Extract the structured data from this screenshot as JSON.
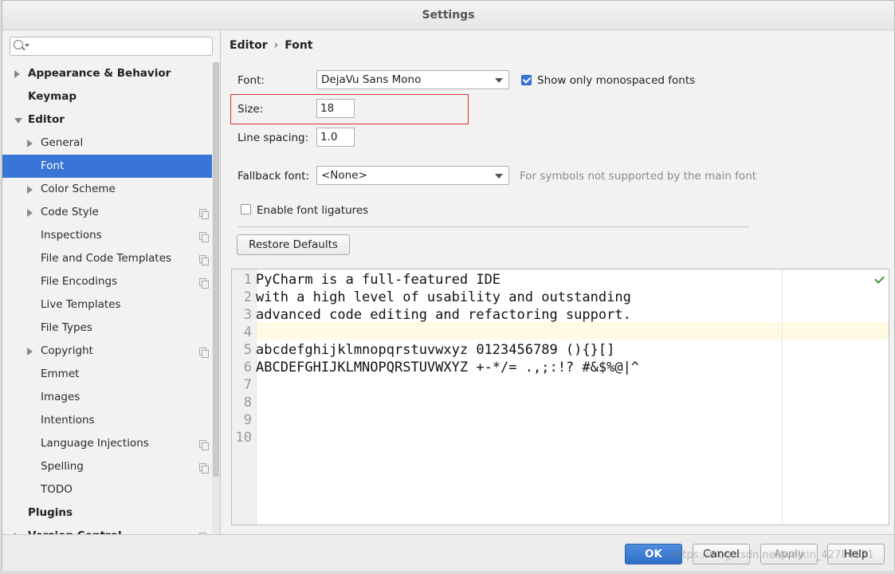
{
  "window": {
    "title": "Settings"
  },
  "search": {
    "placeholder": ""
  },
  "sidebar": {
    "items": [
      {
        "label": "Appearance & Behavior",
        "level": 0,
        "arrow": "right"
      },
      {
        "label": "Keymap",
        "level": 0,
        "arrow": ""
      },
      {
        "label": "Editor",
        "level": 0,
        "arrow": "down"
      },
      {
        "label": "General",
        "level": 1,
        "arrow": "right"
      },
      {
        "label": "Font",
        "level": 1,
        "arrow": "",
        "selected": true
      },
      {
        "label": "Color Scheme",
        "level": 1,
        "arrow": "right"
      },
      {
        "label": "Code Style",
        "level": 1,
        "arrow": "right",
        "copy": true
      },
      {
        "label": "Inspections",
        "level": 1,
        "arrow": "",
        "copy": true
      },
      {
        "label": "File and Code Templates",
        "level": 1,
        "arrow": "",
        "copy": true
      },
      {
        "label": "File Encodings",
        "level": 1,
        "arrow": "",
        "copy": true
      },
      {
        "label": "Live Templates",
        "level": 1,
        "arrow": ""
      },
      {
        "label": "File Types",
        "level": 1,
        "arrow": ""
      },
      {
        "label": "Copyright",
        "level": 1,
        "arrow": "right",
        "copy": true
      },
      {
        "label": "Emmet",
        "level": 1,
        "arrow": ""
      },
      {
        "label": "Images",
        "level": 1,
        "arrow": ""
      },
      {
        "label": "Intentions",
        "level": 1,
        "arrow": ""
      },
      {
        "label": "Language Injections",
        "level": 1,
        "arrow": "",
        "copy": true
      },
      {
        "label": "Spelling",
        "level": 1,
        "arrow": "",
        "copy": true
      },
      {
        "label": "TODO",
        "level": 1,
        "arrow": ""
      },
      {
        "label": "Plugins",
        "level": 0,
        "arrow": ""
      },
      {
        "label": "Version Control",
        "level": 0,
        "arrow": "right",
        "copy": true
      }
    ]
  },
  "breadcrumb": {
    "parent": "Editor",
    "current": "Font",
    "separator": "›"
  },
  "font": {
    "label": "Font:",
    "value": "DejaVu Sans Mono",
    "monospaced_label": "Show only monospaced fonts",
    "monospaced_checked": true
  },
  "size": {
    "label": "Size:",
    "value": "18"
  },
  "line_spacing": {
    "label": "Line spacing:",
    "value": "1.0"
  },
  "fallback": {
    "label": "Fallback font:",
    "value": "<None>",
    "hint": "For symbols not supported by the main font"
  },
  "ligatures": {
    "label": "Enable font ligatures",
    "checked": false
  },
  "restore_defaults": "Restore Defaults",
  "preview": {
    "line_numbers": [
      "1",
      "2",
      "3",
      "4",
      "5",
      "6",
      "7",
      "8",
      "9",
      "10"
    ],
    "lines": [
      "PyCharm is a full-featured IDE",
      "with a high level of usability and outstanding",
      "advanced code editing and refactoring support.",
      "",
      "abcdefghijklmnopqrstuvwxyz 0123456789 (){}[]",
      "ABCDEFGHIJKLMNOPQRSTUVWXYZ +-*/= .,;:!? #&$%@|^",
      "",
      "",
      "",
      ""
    ]
  },
  "buttons": {
    "ok": "OK",
    "cancel": "Cancel",
    "apply": "Apply",
    "help": "Help"
  },
  "watermark": "https://blog.csdn.net/weixin_42784931",
  "colors": {
    "selection": "#3875d7",
    "highlight_box": "#d8322f"
  }
}
